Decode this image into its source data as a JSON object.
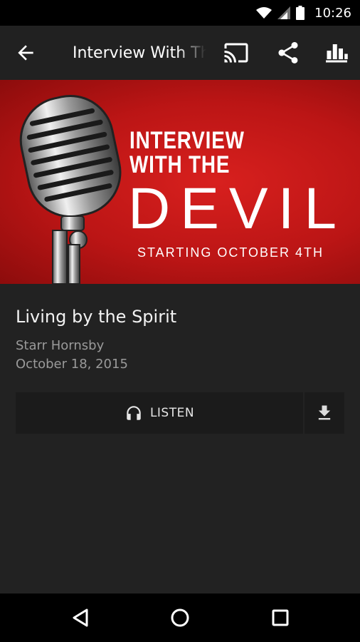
{
  "status_bar": {
    "time": "10:26",
    "icons": [
      "wifi-icon",
      "signal-icon",
      "battery-icon"
    ]
  },
  "app_bar": {
    "title": "Interview With The Devil",
    "actions": [
      "cast-icon",
      "share-icon",
      "equalizer-icon"
    ]
  },
  "banner": {
    "line1": "INTERVIEW",
    "line2": "WITH THE",
    "line3": "DEVIL",
    "line4": "STARTING OCTOBER 4TH"
  },
  "sermon": {
    "title": "Living by the Spirit",
    "speaker": "Starr Hornsby",
    "date": "October 18, 2015"
  },
  "actions": {
    "listen_label": "LISTEN"
  },
  "colors": {
    "background": "#222222",
    "app_bar": "#212121",
    "banner_red": "#c8181a",
    "button_bg": "#1b1b1b",
    "secondary_text": "#9a9a9a"
  }
}
